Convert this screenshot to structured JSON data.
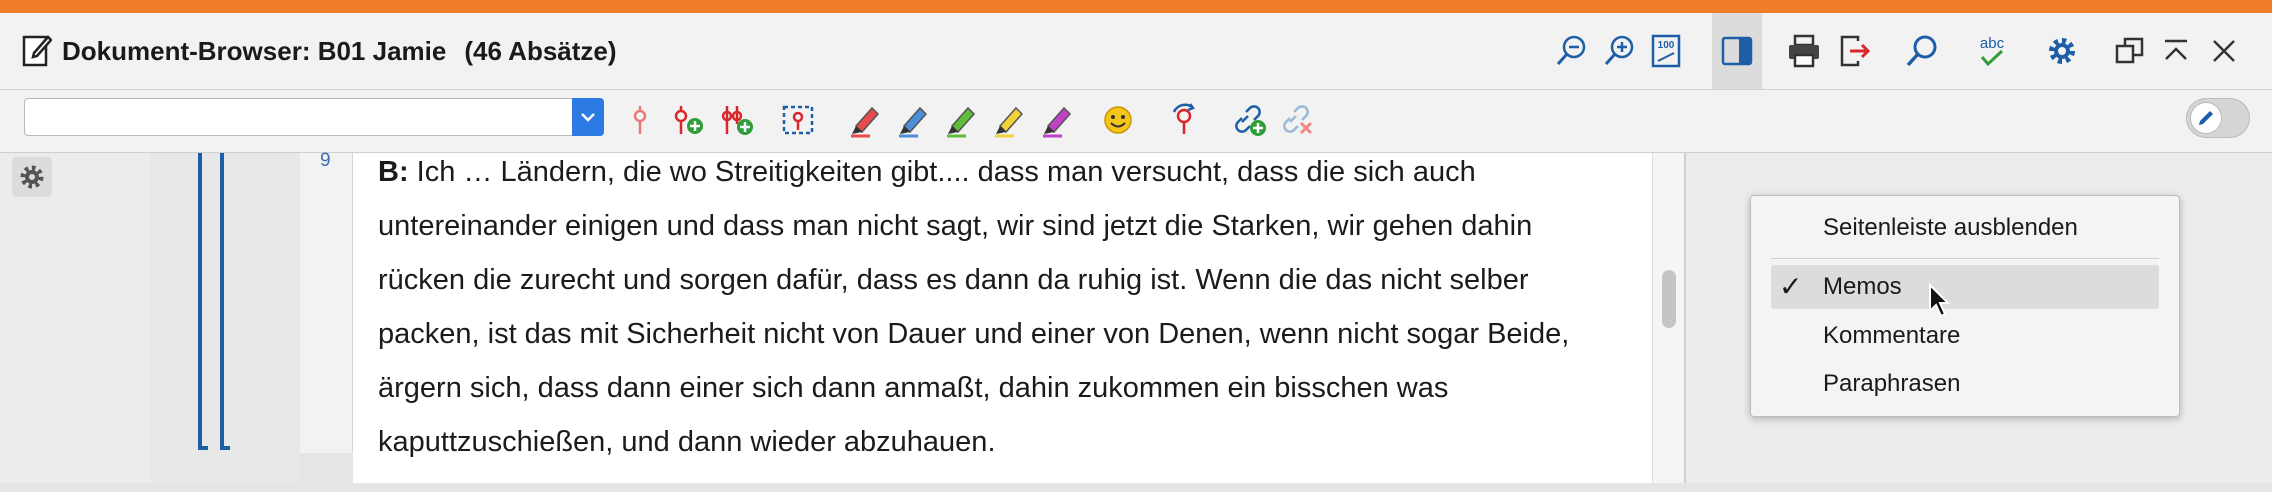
{
  "window": {
    "title": "Dokument-Browser: B01 Jamie",
    "paragraph_count": "(46 Absätze)",
    "accent_color": "#f07d2c"
  },
  "title_toolbar": {
    "icons": [
      "zoom-out-icon",
      "zoom-in-icon",
      "zoom-100-icon",
      "sidebar-toggle-icon",
      "print-icon",
      "export-icon",
      "search-icon",
      "spellcheck-icon",
      "settings-icon",
      "undock-icon",
      "minimize-icon",
      "close-icon"
    ],
    "spellcheck_label": "abc",
    "zoom_label": "100"
  },
  "code_toolbar": {
    "combo_value": "",
    "icons": [
      "code-icon",
      "code-new-icon",
      "code-multi-icon",
      "select-area-icon",
      "highlighter-red-icon",
      "highlighter-blue-icon",
      "highlighter-green-icon",
      "highlighter-yellow-icon",
      "highlighter-purple-icon",
      "emoticon-icon",
      "code-undo-icon",
      "link-add-icon",
      "link-remove-icon"
    ],
    "edit_toggle": "edit-mode-toggle"
  },
  "document": {
    "paragraph_number": "9",
    "speaker": "B:",
    "lines": [
      "Ich … Ländern, die wo Streitigkeiten gibt.... dass man versucht, dass die sich auch",
      "untereinander einigen und dass man nicht sagt, wir sind jetzt die Starken, wir gehen dahin",
      "rücken die zurecht und sorgen dafür, dass es dann da ruhig ist. Wenn die das nicht selber",
      "packen, ist das mit Sicherheit nicht von Dauer und einer von Denen, wenn nicht sogar Beide,",
      "ärgern sich, dass dann einer sich dann anmaßt, dahin zukommen ein bisschen was",
      "kaputtzuschießen, und dann wieder abzuhauen."
    ]
  },
  "context_menu": {
    "items": [
      {
        "label": "Seitenleiste ausblenden",
        "checked": false
      },
      {
        "label": "Memos",
        "checked": true
      },
      {
        "label": "Kommentare",
        "checked": false
      },
      {
        "label": "Paraphrasen",
        "checked": false
      }
    ],
    "check_mark": "✓"
  }
}
